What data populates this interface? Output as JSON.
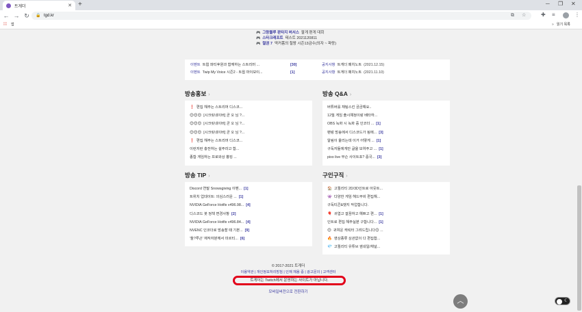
{
  "browser": {
    "tab_title": "트게더",
    "url": "tgd.kr",
    "bookmark_apps": "앱",
    "reading_list": "읽기 목록"
  },
  "notices": [
    {
      "prefix": "그랑블루 판타지 버서스",
      "text": "팔게 편게 대회"
    },
    {
      "prefix": "스타크래프트",
      "text": "테스트 2021120811"
    },
    {
      "prefix": "철권 7",
      "text": "딱커폼의 철왕 시즌13금수(의자 ~ 파랑)"
    }
  ],
  "event_box": {
    "left": [
      {
        "category": "이벤트",
        "title": "트윕 파티후원과 함께하는 스트리머 ...",
        "count": "[30]"
      },
      {
        "category": "이벤트",
        "title": "Twip My Voice 시즌2 - 트윕 마이보이...",
        "count": "[1]"
      }
    ],
    "right": [
      {
        "category": "공지사항",
        "title": "트게더 패치노트",
        "date": "(2021.12.15)"
      },
      {
        "category": "공지사항",
        "title": "트게더 패치노트",
        "date": "(2021.11.10)"
      }
    ]
  },
  "sections": {
    "broadcast_promo": {
      "title": "방송홍보",
      "items": [
        {
          "emoji": "❗",
          "text": "편집 해주는 스트리머 디스코...",
          "count": ""
        },
        {
          "emoji": "😊😊😊",
          "text": "[시크릿네이버] 곧 오 님 ?...",
          "count": ""
        },
        {
          "emoji": "😊😊😊",
          "text": "[시크릿네이버] 곧 오 님 ?...",
          "count": ""
        },
        {
          "emoji": "😊😊😊",
          "text": "[시크릿네이버] 곧 오 님 ?...",
          "count": ""
        },
        {
          "emoji": "❗",
          "text": "편집 해주는 스트리머 디스코...",
          "count": ""
        },
        {
          "emoji": "",
          "text": "이런저런 충전하는 설주라고 합...",
          "count": ""
        },
        {
          "emoji": "",
          "text": "종합 게임하는 프로와상 뿡킹 ...",
          "count": ""
        }
      ]
    },
    "broadcast_qa": {
      "title": "방송 Q&A",
      "items": [
        {
          "text": "버튜버를 채팅스킨 궁금해요..",
          "count": ""
        },
        {
          "text": "12월 게임 출시예정이랑 베타하...",
          "count": ""
        },
        {
          "text": "OBS 녹화 시 녹화 중 인코더 ...",
          "count": "[1]"
        },
        {
          "text": "팬렁 방송에서 디스코드가 됨에...",
          "count": "[3]"
        },
        {
          "text": "알림이 울리는데 이거 어떻게 ...",
          "count": "[1]"
        },
        {
          "text": "구독자들에게만 글을 보여주고 ...",
          "count": "[1]"
        },
        {
          "text": "pixo live 무슨 사이트죠? 중국...",
          "count": "[3]"
        }
      ]
    },
    "broadcast_tip": {
      "title": "방송 TIP",
      "items": [
        {
          "text": "Discord 연말 Snowsgiving 이벤...",
          "count": "[1]"
        },
        {
          "text": "트위치 업데이트: 의심스러운 ...",
          "count": "[1]"
        },
        {
          "text": "NVIDIA GeForce Hotfix v496.98...",
          "count": "[4]"
        },
        {
          "text": "디스코드 봇 정책 변경사항",
          "count": "[2]"
        },
        {
          "text": "NVIDIA GeForce Hotfix v496.84...",
          "count": "[4]"
        },
        {
          "text": "NVENC 인코더로 방송할 때 기본...",
          "count": "[9]"
        },
        {
          "text": "'돌?루곤' 재작자분께서 미르티...",
          "count": "[6]"
        }
      ]
    },
    "jobs": {
      "title": "구인구직",
      "items": [
        {
          "emoji": "🏠",
          "text": "고퀄리티 2D/3D인트로 아웃트...",
          "count": ""
        },
        {
          "emoji": "👾",
          "text": "다양한 게임 헤드무비 편집해...",
          "count": ""
        },
        {
          "emoji": "",
          "text": "구독티콘&뱃지 작업합니다.",
          "count": ""
        },
        {
          "emoji": "🎈",
          "text": "귀엽고 깔끔하고 예쁘고 편...",
          "count": "[1]"
        },
        {
          "emoji": "",
          "text": "인트로 편집 해주실분 구합니다...",
          "count": "[1]"
        },
        {
          "emoji": "😊",
          "text": "귀여운 캐릭터 그려드립니다😊 ...",
          "count": ""
        },
        {
          "emoji": "🔥",
          "text": "영상종류 상관없이 다 편집합...",
          "count": ""
        },
        {
          "emoji": "💎",
          "text": "고퀄리티 유튜브 썸네일/채널...",
          "count": ""
        }
      ]
    }
  },
  "footer": {
    "copyright": "© 2017-2021 트게더",
    "links": "이용약관 | 개인정보처리방침 | 인재 채용 중 | 광고문의 | 고객센터",
    "disclaimer": "트게더는 Twitch에서 운영하는 사이트가 아닙니다.",
    "mobile": "모바일버전으로 전환하기"
  },
  "colors": {
    "accent": "#3a3aa0",
    "highlight": "#e2001a",
    "brand": "#7e57c2"
  }
}
